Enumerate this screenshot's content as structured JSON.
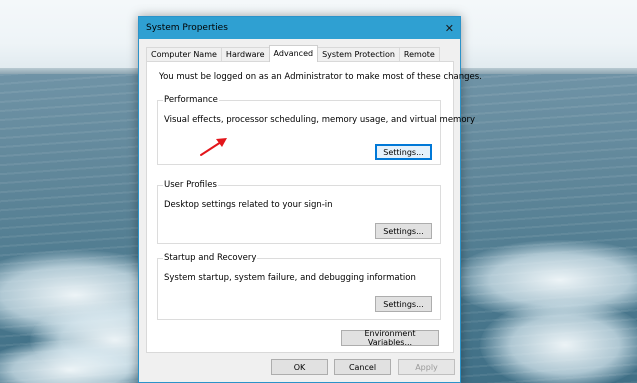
{
  "window": {
    "title": "System Properties",
    "close_glyph": "✕"
  },
  "tabs": [
    {
      "label": "Computer Name"
    },
    {
      "label": "Hardware"
    },
    {
      "label": "Advanced"
    },
    {
      "label": "System Protection"
    },
    {
      "label": "Remote"
    }
  ],
  "active_tab": "Advanced",
  "notice": "You must be logged on as an Administrator to make most of these changes.",
  "performance": {
    "label": "Performance",
    "description": "Visual effects, processor scheduling, memory usage, and virtual memory",
    "button": "Settings..."
  },
  "user_profiles": {
    "label": "User Profiles",
    "description": "Desktop settings related to your sign-in",
    "button": "Settings..."
  },
  "startup_recovery": {
    "label": "Startup and Recovery",
    "description": "System startup, system failure, and debugging information",
    "button": "Settings..."
  },
  "environment_button": "Environment Variables...",
  "footer": {
    "ok": "OK",
    "cancel": "Cancel",
    "apply": "Apply"
  },
  "icons": {
    "close": "close-icon",
    "annotation": "red-arrow-icon"
  },
  "colors": {
    "titlebar": "#2fa0d2",
    "focus_border": "#0078d7",
    "annotation_arrow": "#e3161b"
  }
}
